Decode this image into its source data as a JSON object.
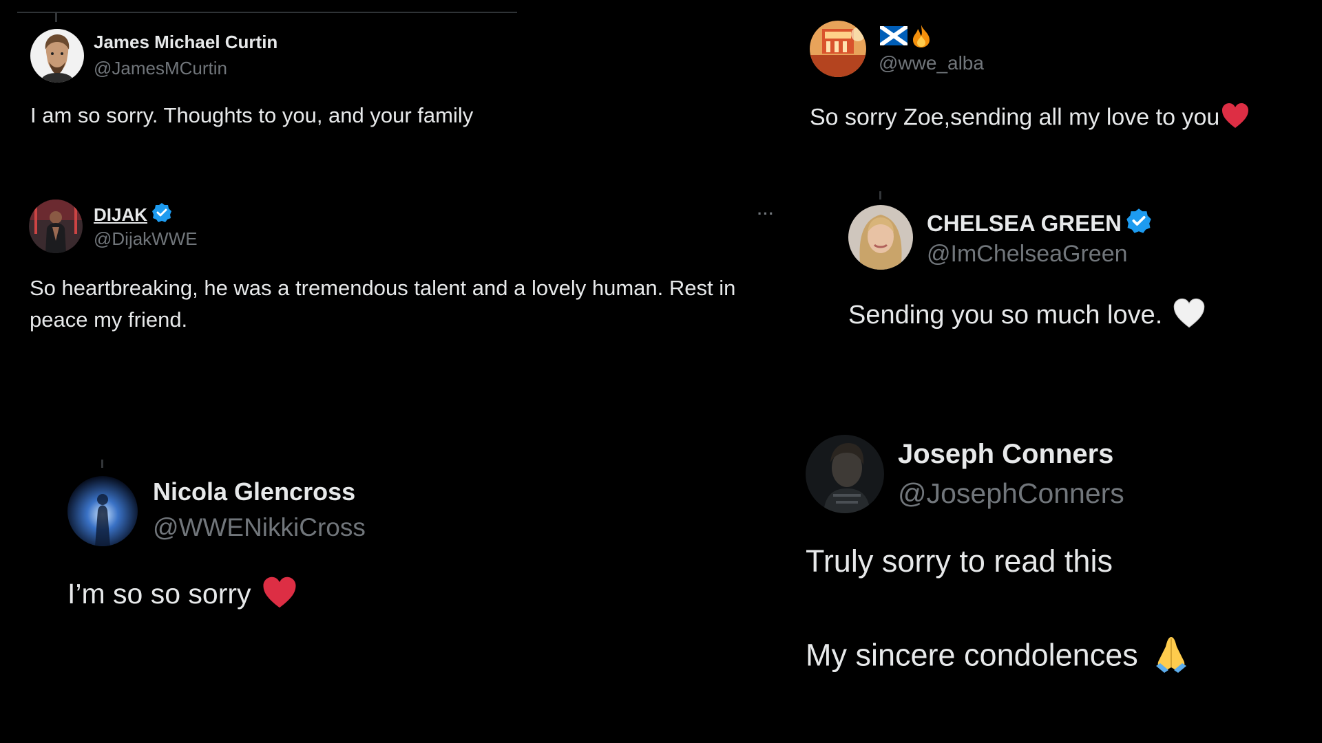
{
  "posts": [
    {
      "display_name": "James Michael Curtin",
      "handle": "@JamesMCurtin",
      "text": "I am so sorry. Thoughts to you, and your family",
      "avatar_icon": "illustrated-man-avatar"
    },
    {
      "display_name": "",
      "handle": "@wwe_alba",
      "text": "So sorry Zoe,sending all my love to you",
      "name_emojis": [
        "scotland-flag-icon",
        "fire-icon"
      ],
      "text_emoji": "red-heart-icon",
      "avatar_icon": "arena-stage-avatar"
    },
    {
      "display_name": "DIJAK",
      "handle": "@DijakWWE",
      "verified": true,
      "text": "So heartbreaking, he was a tremendous talent and a lovely human. Rest in peace my friend.",
      "more_label": "···",
      "avatar_icon": "wrestler-entrance-avatar"
    },
    {
      "display_name": "CHELSEA GREEN",
      "handle": "@ImChelseaGreen",
      "verified": true,
      "text": "Sending you so much love.",
      "text_emoji": "white-heart-icon",
      "avatar_icon": "blonde-woman-avatar"
    },
    {
      "display_name": "Nicola Glencross",
      "handle": "@WWENikkiCross",
      "text": "I’m so so sorry",
      "text_emoji": "red-heart-icon",
      "avatar_icon": "blue-spotlight-avatar"
    },
    {
      "display_name": "Joseph Conners",
      "handle": "@JosephConners",
      "text_line1": "Truly sorry to read this",
      "text_line2": "My sincere condolences",
      "text_emoji": "folded-hands-icon",
      "avatar_icon": "dark-portrait-avatar"
    }
  ],
  "colors": {
    "background": "#000000",
    "primary_text": "#e7e9ea",
    "secondary_text": "#71767b",
    "verified_blue": "#1d9bf0",
    "heart_red": "#e0245e"
  }
}
